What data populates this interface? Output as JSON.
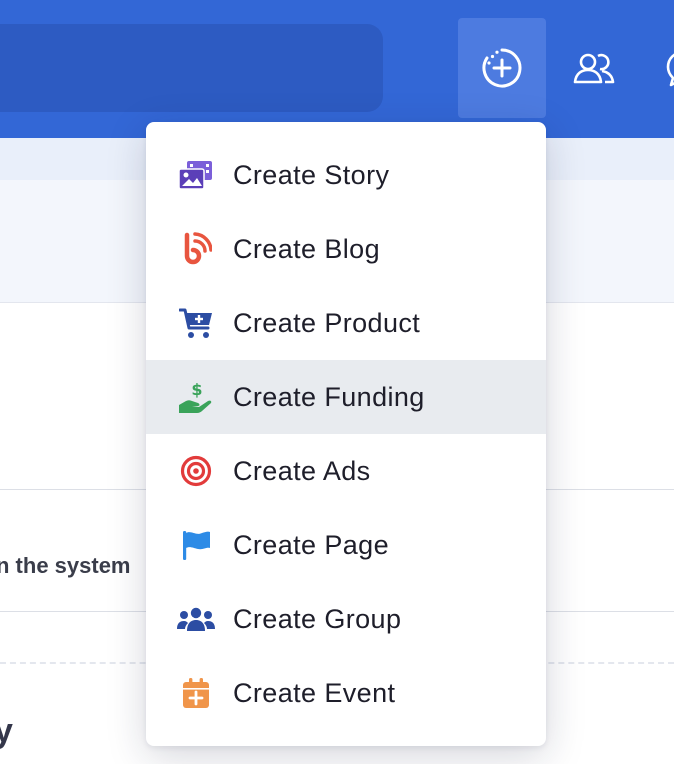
{
  "header": {
    "create_button": {
      "icon": "plus-circle-icon"
    },
    "friends_button": {
      "icon": "friends-icon"
    },
    "chat_button": {
      "icon": "chat-icon"
    }
  },
  "background": {
    "partial_text": "n the system",
    "partial_heading": "y"
  },
  "dropdown": {
    "items": [
      {
        "label": "Create Story",
        "icon": "story-images-icon",
        "color": "#5b3fb8"
      },
      {
        "label": "Create Blog",
        "icon": "blog-rss-icon",
        "color": "#e8553f"
      },
      {
        "label": "Create Product",
        "icon": "cart-plus-icon",
        "color": "#2c4da3"
      },
      {
        "label": "Create Funding",
        "icon": "hand-dollar-icon",
        "color": "#3aa35a",
        "active": true
      },
      {
        "label": "Create Ads",
        "icon": "target-icon",
        "color": "#e23b3b"
      },
      {
        "label": "Create Page",
        "icon": "flag-icon",
        "color": "#2d8be6"
      },
      {
        "label": "Create Group",
        "icon": "group-users-icon",
        "color": "#2c4da3"
      },
      {
        "label": "Create Event",
        "icon": "calendar-plus-icon",
        "color": "#f0954a"
      }
    ]
  }
}
